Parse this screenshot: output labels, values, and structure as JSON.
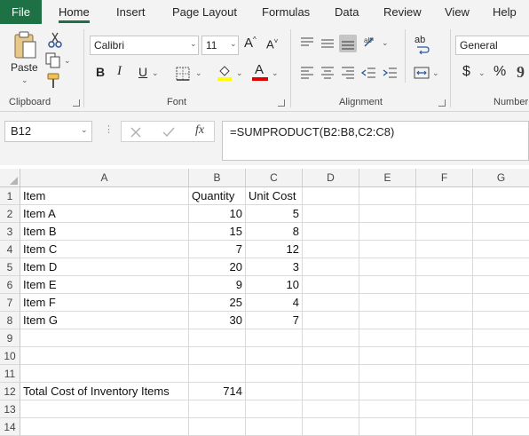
{
  "menu": {
    "file": "File",
    "tabs": [
      "Home",
      "Insert",
      "Page Layout",
      "Formulas",
      "Data",
      "Review",
      "View",
      "Help"
    ]
  },
  "ribbon": {
    "clipboard": {
      "paste_label": "Paste",
      "group_label": "Clipboard"
    },
    "font": {
      "font_name": "Calibri",
      "font_size": "11",
      "bold": "B",
      "italic": "I",
      "underline": "U",
      "font_color_glyph": "A",
      "group_label": "Font",
      "highlight_color": "#ffff00",
      "font_color": "#e00000"
    },
    "alignment": {
      "group_label": "Alignment",
      "wrap_glyph": "ab"
    },
    "number": {
      "format": "General",
      "currency": "$",
      "percent": "%",
      "group_label": "Number"
    }
  },
  "formula_bar": {
    "name_box": "B12",
    "fx_label": "fx",
    "formula": "=SUMPRODUCT(B2:B8,C2:C8)"
  },
  "sheet": {
    "columns": [
      "A",
      "B",
      "C",
      "D",
      "E",
      "F",
      "G"
    ],
    "row_numbers": [
      "1",
      "2",
      "3",
      "4",
      "5",
      "6",
      "7",
      "8",
      "9",
      "10",
      "11",
      "12",
      "13",
      "14"
    ],
    "rows": [
      [
        "Item",
        "Quantity",
        "Unit Cost"
      ],
      [
        "Item A",
        "10",
        "5"
      ],
      [
        "Item B",
        "15",
        "8"
      ],
      [
        "Item C",
        "7",
        "12"
      ],
      [
        "Item D",
        "20",
        "3"
      ],
      [
        "Item E",
        "9",
        "10"
      ],
      [
        "Item F",
        "25",
        "4"
      ],
      [
        "Item G",
        "30",
        "7"
      ],
      [
        "",
        "",
        ""
      ],
      [
        "",
        "",
        ""
      ],
      [
        "",
        "",
        ""
      ],
      [
        "Total Cost of Inventory Items",
        "714",
        ""
      ],
      [
        "",
        "",
        ""
      ],
      [
        "",
        "",
        ""
      ]
    ]
  }
}
